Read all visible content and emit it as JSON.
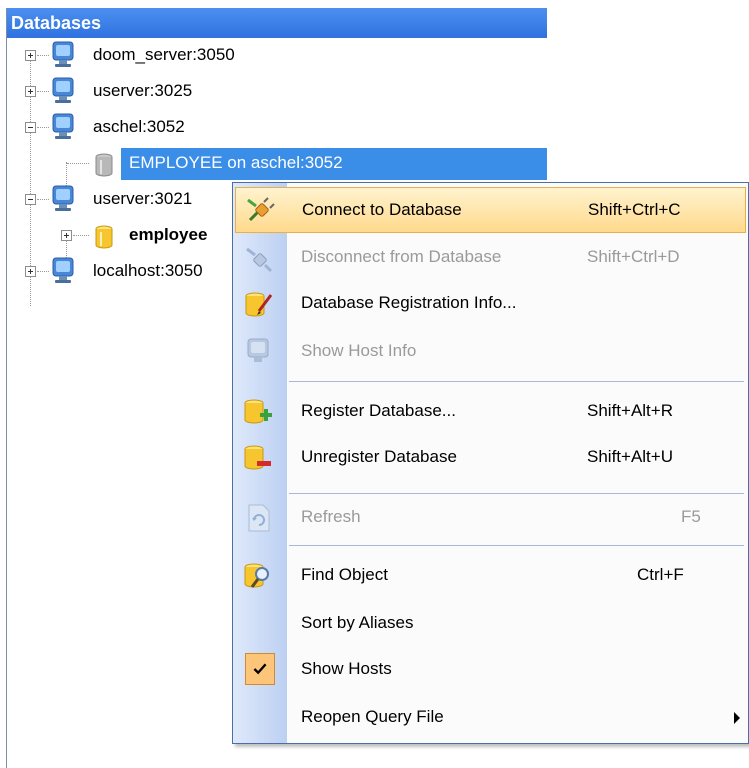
{
  "panel": {
    "title": "Databases"
  },
  "tree": {
    "items": [
      {
        "label": "doom_server:3050",
        "icon": "host-icon",
        "expander": "plus"
      },
      {
        "label": "userver:3025",
        "icon": "host-icon",
        "expander": "plus"
      },
      {
        "label": "aschel:3052",
        "icon": "host-icon",
        "expander": "minus"
      },
      {
        "label": "EMPLOYEE on aschel:3052",
        "icon": "database-disconnected-icon",
        "selected": true
      },
      {
        "label": "userver:3021",
        "icon": "host-icon",
        "expander": "minus"
      },
      {
        "label": "employee",
        "icon": "database-connected-icon",
        "expander": "plus",
        "bold": true
      },
      {
        "label": "localhost:3050",
        "icon": "host-icon",
        "expander": "plus"
      }
    ]
  },
  "menu": {
    "items": [
      {
        "label": "Connect to Database",
        "shortcut": "Shift+Ctrl+C",
        "icon": "connect-plug-icon",
        "highlighted": true
      },
      {
        "label": "Disconnect from Database",
        "shortcut": "Shift+Ctrl+D",
        "icon": "disconnect-plug-icon",
        "disabled": true
      },
      {
        "label": "Database Registration Info...",
        "shortcut": "",
        "icon": "registration-info-icon"
      },
      {
        "label": "Show Host Info",
        "shortcut": "",
        "icon": "host-info-icon",
        "disabled": true
      },
      {
        "label": "Register Database...",
        "shortcut": "Shift+Alt+R",
        "icon": "register-database-icon"
      },
      {
        "label": "Unregister Database",
        "shortcut": "Shift+Alt+U",
        "icon": "unregister-database-icon"
      },
      {
        "label": "Refresh",
        "shortcut": "F5",
        "icon": "refresh-icon",
        "disabled": true
      },
      {
        "label": "Find Object",
        "shortcut": "Ctrl+F",
        "icon": "find-object-icon"
      },
      {
        "label": "Sort by Aliases",
        "shortcut": "",
        "icon": ""
      },
      {
        "label": "Show Hosts",
        "shortcut": "",
        "icon": "checkmark-icon",
        "checked": true
      },
      {
        "label": "Reopen Query File",
        "shortcut": "",
        "icon": "",
        "submenu": true
      }
    ]
  },
  "colors": {
    "header_blue": "#2f72e0",
    "selection_blue": "#3a8ee8",
    "highlight_orange": "#ffd98c",
    "check_orange": "#fcc57a"
  }
}
